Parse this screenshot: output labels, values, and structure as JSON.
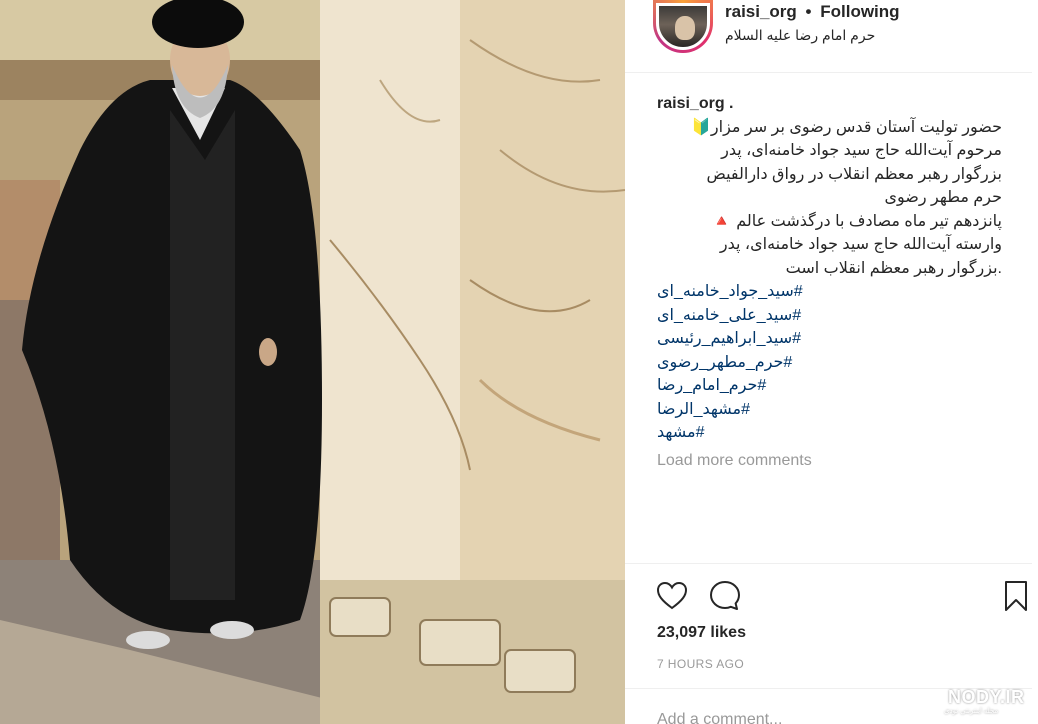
{
  "post": {
    "username": "raisi_org",
    "separator": "•",
    "follow_status": "Following",
    "location": "حرم امام رضا علیه السلام"
  },
  "caption": {
    "owner": "raisi_org .",
    "lines": [
      "حضور تولیت آستان قدس رضوی بر سر مزار🔰",
      "مرحوم آیت‌الله حاج سید جواد خامنه‌ای، پدر",
      "بزرگوار رهبر معظم انقلاب در رواق دارالفیض",
      "حرم مطهر رضوی",
      "پانزدهم تیر ماه مصادف با درگذشت عالم 🔺",
      "وارسته آیت‌الله حاج سید جواد خامنه‌ای، پدر",
      ".بزرگوار رهبر معظم انقلاب است"
    ],
    "hashtags": [
      "#سید_جواد_خامنه_ای",
      "#سید_علی_خامنه_ای",
      "#سید_ابراهیم_رئیسی",
      "#حرم_مطهر_رضوی",
      "#حرم_امام_رضا",
      "#مشهد_الرضا",
      "#مشهد"
    ]
  },
  "comments": {
    "load_more": "Load more comments",
    "input_placeholder": "Add a comment..."
  },
  "stats": {
    "likes": "23,097 likes",
    "time": "7 HOURS AGO"
  },
  "icons": {
    "like": "heart-icon",
    "comment": "speech-bubble-icon",
    "save": "bookmark-icon"
  },
  "watermark": {
    "text": "NODY.IR",
    "sub": "مجله اینترنتی نودی"
  },
  "colors": {
    "hashtag": "#003569",
    "muted": "#999999",
    "text": "#262626"
  }
}
